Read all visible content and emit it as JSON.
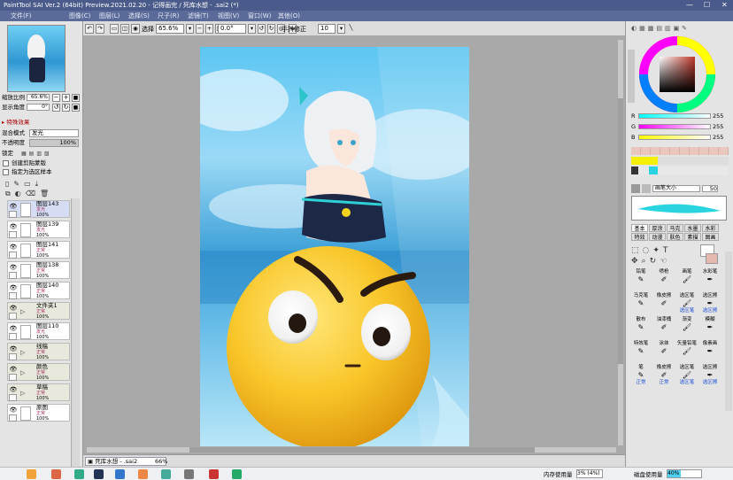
{
  "window": {
    "title": "PaintTool SAI Ver.2 (64bit) Preview.2021.02.20 - 记得画完 / 死库水想 - .sai2 (*)",
    "min": "—",
    "max": "☐",
    "close": "✕"
  },
  "menu": [
    "文件(F)",
    "图像(C)",
    "图层(L)",
    "选择(S)",
    "尺子(R)",
    "滤镜(T)",
    "视图(V)",
    "窗口(W)",
    "其他(O)"
  ],
  "toolbar": {
    "select_label": "选择",
    "zoom": "65.6%",
    "angle": "0.0°",
    "stabilizer_label": "手抖修正",
    "stabilizer": "10"
  },
  "navigator": {
    "zoom_label": "缩放比例",
    "zoom": "65.6%",
    "angle_label": "显示角度",
    "angle": "0°"
  },
  "layer_props": {
    "effects": "特殊效果",
    "blend_label": "混合模式",
    "blend": "发光",
    "opacity_label": "不透明度",
    "opacity": "100%",
    "lock_label": "锁定",
    "clip_label": "创建剪贴蒙版",
    "sample_label": "指定为选区样本"
  },
  "layers": [
    {
      "name": "图层143",
      "mode": "发光",
      "opacity": "100%",
      "folder": false
    },
    {
      "name": "图层139",
      "mode": "发光",
      "opacity": "100%",
      "folder": false
    },
    {
      "name": "图层141",
      "mode": "正常",
      "opacity": "100%",
      "folder": false
    },
    {
      "name": "图层138",
      "mode": "正常",
      "opacity": "100%",
      "folder": false
    },
    {
      "name": "图层140",
      "mode": "正常",
      "opacity": "100%",
      "folder": false
    },
    {
      "name": "文件夹1",
      "mode": "正常",
      "opacity": "100%",
      "folder": true
    },
    {
      "name": "图层110",
      "mode": "发光",
      "opacity": "100%",
      "folder": false
    },
    {
      "name": "线稿",
      "mode": "正常",
      "opacity": "100%",
      "folder": true
    },
    {
      "name": "颜色",
      "mode": "正常",
      "opacity": "100%",
      "folder": true
    },
    {
      "name": "草稿",
      "mode": "正常",
      "opacity": "100%",
      "folder": true
    },
    {
      "name": "原图",
      "mode": "正常",
      "opacity": "100%",
      "folder": false
    }
  ],
  "status": {
    "doc_tab": "死库水想 - .sai2",
    "doc_zoom": "66%",
    "mem_label": "内存使用量",
    "mem": "3% (4%)",
    "disk_label": "磁盘使用量",
    "disk": "40%"
  },
  "color": {
    "r_label": "R",
    "r": "255",
    "g_label": "G",
    "g": "255",
    "b_label": "B",
    "b": "255",
    "hue_color": "#c0392b"
  },
  "brush": {
    "size_label": "画笔大小",
    "size": "50"
  },
  "tool_tabs": [
    "基本",
    "厚涂",
    "马克",
    "水墨",
    "水彩"
  ],
  "tool_tabs2": [
    "特效",
    "动漫",
    "肤色",
    "素描",
    "图画"
  ],
  "tools_row1": [
    {
      "name": "铅笔",
      "mode": ""
    },
    {
      "name": "喷枪",
      "mode": ""
    },
    {
      "name": "画笔",
      "mode": ""
    },
    {
      "name": "水彩笔",
      "mode": ""
    }
  ],
  "tools_row2": [
    {
      "name": "马克笔",
      "mode": ""
    },
    {
      "name": "橡皮擦",
      "mode": ""
    },
    {
      "name": "选区笔",
      "mode": "选区笔"
    },
    {
      "name": "选区擦",
      "mode": "选区擦"
    }
  ],
  "tools_row3": [
    {
      "name": "散布",
      "mode": ""
    },
    {
      "name": "油漆桶",
      "mode": ""
    },
    {
      "name": "渐变",
      "mode": ""
    },
    {
      "name": "模糊",
      "mode": ""
    }
  ],
  "tools_row4": [
    {
      "name": "特效笔",
      "mode": ""
    },
    {
      "name": "涂抹",
      "mode": ""
    },
    {
      "name": "矢量铅笔",
      "mode": ""
    },
    {
      "name": "像素画",
      "mode": ""
    }
  ],
  "tools_row5": [
    {
      "name": "笔",
      "mode": "正常"
    },
    {
      "name": "橡皮擦",
      "mode": "正常"
    },
    {
      "name": "选区笔",
      "mode": "选区笔"
    },
    {
      "name": "选区擦",
      "mode": "选区擦"
    }
  ]
}
